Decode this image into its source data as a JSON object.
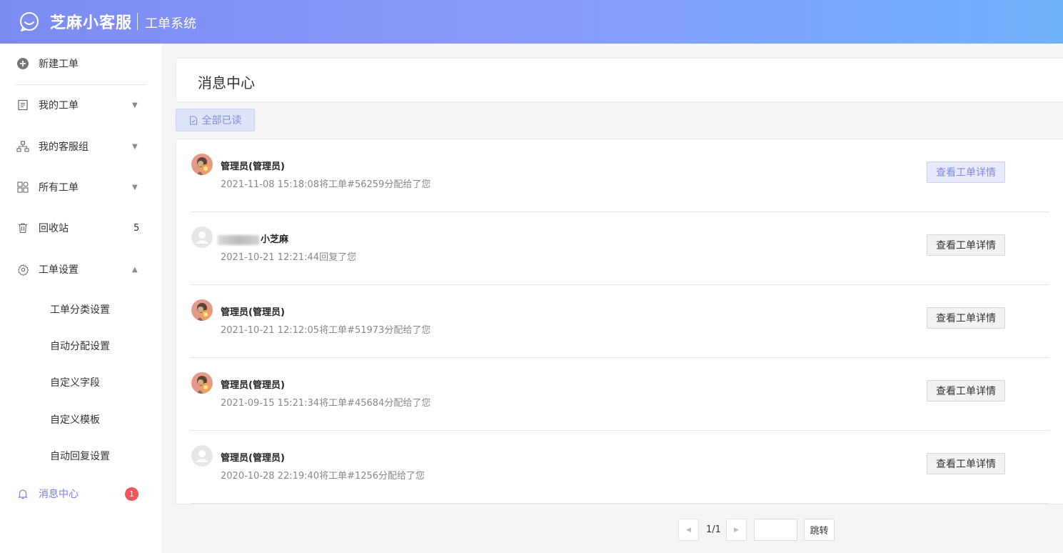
{
  "header": {
    "brand": "芝麻小客服",
    "subtitle": "工单系统"
  },
  "sidebar": {
    "new_ticket": "新建工单",
    "items": [
      {
        "label": "我的工单"
      },
      {
        "label": "我的客服组"
      },
      {
        "label": "所有工单"
      },
      {
        "label": "回收站",
        "count": "5"
      },
      {
        "label": "工单设置"
      }
    ],
    "sub_items": [
      "工单分类设置",
      "自动分配设置",
      "自定义字段",
      "自定义模板",
      "自动回复设置"
    ],
    "message_center": {
      "label": "消息中心",
      "badge": "1"
    }
  },
  "main": {
    "title": "消息中心",
    "read_all": "全部已读",
    "detail_label": "查看工单详情",
    "messages": [
      {
        "name": "管理员(管理员)",
        "text": "2021-11-08 15:18:08将工单#56259分配给了您",
        "avatar": "photo"
      },
      {
        "name": "小芝麻",
        "text": "2021-10-21 12:21:44回复了您",
        "avatar": "default"
      },
      {
        "name": "管理员(管理员)",
        "text": "2021-10-21 12:12:05将工单#51973分配给了您",
        "avatar": "photo"
      },
      {
        "name": "管理员(管理员)",
        "text": "2021-09-15 15:21:34将工单#45684分配给了您",
        "avatar": "photo"
      },
      {
        "name": "管理员(管理员)",
        "text": "2020-10-28 22:19:40将工单#1256分配给了您",
        "avatar": "default"
      }
    ]
  },
  "pagination": {
    "page": "1/1",
    "go": "跳转"
  },
  "colors": {
    "accent": "#7381e8",
    "badge": "#f0555b"
  }
}
